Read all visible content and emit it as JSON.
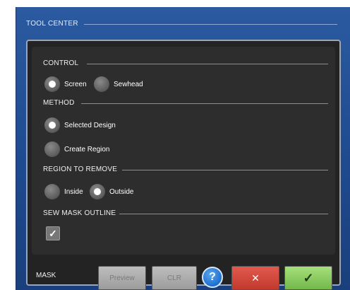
{
  "window": {
    "title": "TOOL CENTER"
  },
  "control": {
    "label": "CONTROL",
    "options": [
      {
        "label": "Screen",
        "selected": true
      },
      {
        "label": "Sewhead",
        "selected": false
      }
    ]
  },
  "method": {
    "label": "METHOD",
    "options": [
      {
        "label": "Selected Design",
        "selected": true
      },
      {
        "label": "Create Region",
        "selected": false
      }
    ]
  },
  "region": {
    "label": "REGION TO REMOVE",
    "options": [
      {
        "label": "Inside",
        "selected": false
      },
      {
        "label": "Outside",
        "selected": true
      }
    ]
  },
  "sew_mask": {
    "label": "SEW MASK OUTLINE",
    "checked": true,
    "check_glyph": "✓"
  },
  "footer": {
    "label": "MASK",
    "preview_label": "Preview",
    "clr_label": "CLR",
    "help_glyph": "?",
    "cancel_glyph": "✕",
    "ok_glyph": "✓"
  },
  "colors": {
    "window_blue": "#2b5aa0",
    "cancel_red": "#c23a2e",
    "ok_green": "#73b84c",
    "help_blue": "#1e6fcf"
  }
}
